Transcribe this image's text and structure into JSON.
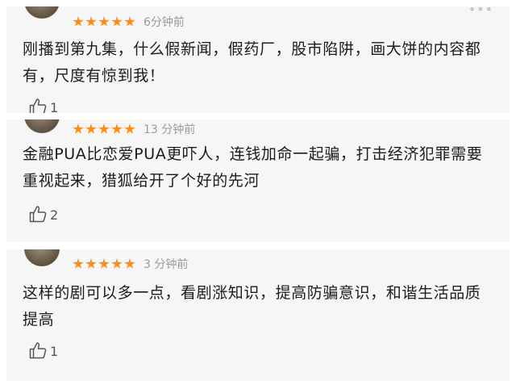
{
  "comments": [
    {
      "rating": 5,
      "time": "6分钟前",
      "text": "刚播到第九集，什么假新闻，假药厂，股市陷阱，画大饼的内容都有，尺度有惊到我！",
      "likes": "1"
    },
    {
      "rating": 5,
      "time": "13 分钟前",
      "text": "金融PUA比恋爱PUA更吓人，连钱加命一起骗，打击经济犯罪需要重视起来，猎狐给开了个好的先河",
      "likes": "2"
    },
    {
      "rating": 5,
      "time": "3 分钟前",
      "text": "这样的剧可以多一点，看剧涨知识，提高防骗意识，和谐生活品质提高",
      "likes": "1"
    }
  ],
  "icons": {
    "more": "more-icon",
    "like": "thumbs-up-icon",
    "star": "star-icon"
  },
  "colors": {
    "star": "#ff8c1a",
    "time": "#9a9a9a",
    "card_background": "#f6f6f6",
    "text": "#1c1c1c"
  }
}
